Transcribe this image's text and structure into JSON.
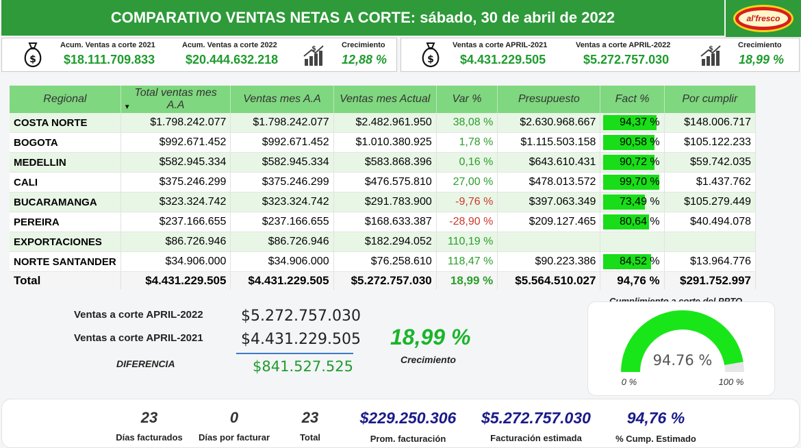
{
  "header": {
    "title": "COMPARATIVO VENTAS NETAS A CORTE:  sábado, 30 de abril de 2022",
    "logo_text": "al'fresco"
  },
  "kpis_left": {
    "acum_2021_label": "Acum. Ventas a corte 2021",
    "acum_2021_value": "$18.111.709.833",
    "acum_2022_label": "Acum. Ventas a corte 2022",
    "acum_2022_value": "$20.444.632.218",
    "growth_label": "Crecimiento",
    "growth_value": "12,88 %"
  },
  "kpis_right": {
    "month_2021_label": "Ventas a corte APRIL-2021",
    "month_2021_value": "$4.431.229.505",
    "month_2022_label": "Ventas a corte APRIL-2022",
    "month_2022_value": "$5.272.757.030",
    "growth_label": "Crecimiento",
    "growth_value": "18,99 %"
  },
  "table": {
    "headers": [
      "Regional",
      "Total ventas mes A.A",
      "Ventas mes A.A",
      "Ventas mes Actual",
      "Var %",
      "Presupuesto",
      "Fact %",
      "Por cumplir"
    ],
    "rows": [
      {
        "regional": "COSTA NORTE",
        "total_aa": "$1.798.242.077",
        "ventas_aa": "$1.798.242.077",
        "actual": "$2.482.961.950",
        "var": "38,08 %",
        "var_sign": "pos",
        "presupuesto": "$2.630.968.667",
        "fact": "94,37 %",
        "fact_pct": 94.37,
        "por_cumplir": "$148.006.717"
      },
      {
        "regional": "BOGOTA",
        "total_aa": "$992.671.452",
        "ventas_aa": "$992.671.452",
        "actual": "$1.010.380.925",
        "var": "1,78 %",
        "var_sign": "pos",
        "presupuesto": "$1.115.503.158",
        "fact": "90,58 %",
        "fact_pct": 90.58,
        "por_cumplir": "$105.122.233"
      },
      {
        "regional": "MEDELLIN",
        "total_aa": "$582.945.334",
        "ventas_aa": "$582.945.334",
        "actual": "$583.868.396",
        "var": "0,16 %",
        "var_sign": "pos",
        "presupuesto": "$643.610.431",
        "fact": "90,72 %",
        "fact_pct": 90.72,
        "por_cumplir": "$59.742.035"
      },
      {
        "regional": "CALI",
        "total_aa": "$375.246.299",
        "ventas_aa": "$375.246.299",
        "actual": "$476.575.810",
        "var": "27,00 %",
        "var_sign": "pos",
        "presupuesto": "$478.013.572",
        "fact": "99,70 %",
        "fact_pct": 99.7,
        "por_cumplir": "$1.437.762"
      },
      {
        "regional": "BUCARAMANGA",
        "total_aa": "$323.324.742",
        "ventas_aa": "$323.324.742",
        "actual": "$291.783.900",
        "var": "-9,76 %",
        "var_sign": "neg",
        "presupuesto": "$397.063.349",
        "fact": "73,49 %",
        "fact_pct": 73.49,
        "por_cumplir": "$105.279.449"
      },
      {
        "regional": "PEREIRA",
        "total_aa": "$237.166.655",
        "ventas_aa": "$237.166.655",
        "actual": "$168.633.387",
        "var": "-28,90 %",
        "var_sign": "neg",
        "presupuesto": "$209.127.465",
        "fact": "80,64 %",
        "fact_pct": 80.64,
        "por_cumplir": "$40.494.078"
      },
      {
        "regional": "EXPORTACIONES",
        "total_aa": "$86.726.946",
        "ventas_aa": "$86.726.946",
        "actual": "$182.294.052",
        "var": "110,19 %",
        "var_sign": "pos",
        "presupuesto": "",
        "fact": "",
        "fact_pct": null,
        "por_cumplir": ""
      },
      {
        "regional": "NORTE SANTANDER",
        "total_aa": "$34.906.000",
        "ventas_aa": "$34.906.000",
        "actual": "$76.258.610",
        "var": "118,47 %",
        "var_sign": "pos",
        "presupuesto": "$90.223.386",
        "fact": "84,52 %",
        "fact_pct": 84.52,
        "por_cumplir": "$13.964.776"
      }
    ],
    "total": {
      "regional": "Total",
      "total_aa": "$4.431.229.505",
      "ventas_aa": "$4.431.229.505",
      "actual": "$5.272.757.030",
      "var": "18,99 %",
      "presupuesto": "$5.564.510.027",
      "fact": "94,76 %",
      "por_cumplir": "$291.752.997"
    }
  },
  "comparison": {
    "label_2022": "Ventas a corte APRIL-2022",
    "value_2022": "$5.272.757.030",
    "label_2021": "Ventas a corte APRIL-2021",
    "value_2021": "$4.431.229.505",
    "diff_label": "DIFERENCIA",
    "diff_value": "$841.527.525",
    "growth_value": "18,99 %",
    "growth_label": "Crecimiento"
  },
  "gauge": {
    "title": "Cumplimiento a corte del PPTO",
    "value_text": "94.76 %",
    "value_pct": 94.76,
    "min_label": "0 %",
    "max_label": "100 %",
    "fill_color": "#19e619",
    "track_color": "#e6e6e6"
  },
  "bottom": {
    "dias_facturados_value": "23",
    "dias_facturados_label": "Días facturados",
    "dias_por_facturar_value": "0",
    "dias_por_facturar_label": "Días por facturar",
    "total_value": "23",
    "total_label": "Total",
    "prom_value": "$229.250.306",
    "prom_label": "Prom. facturación",
    "fact_est_value": "$5.272.757.030",
    "fact_est_label": "Facturación estimada",
    "cump_value": "94,76 %",
    "cump_label": "% Cump. Estimado"
  }
}
